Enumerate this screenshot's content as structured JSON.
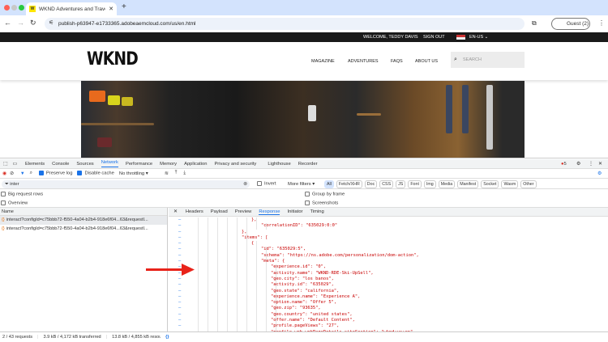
{
  "browser": {
    "tab_title": "WKND Adventures and Travel",
    "url": "publish-p63947-e1733365.adobeaemcloud.com/us/en.html",
    "profile": "Guest (2)"
  },
  "site": {
    "welcome": "WELCOME, TEDDY DAVIS",
    "sign_out": "SIGN OUT",
    "locale": "EN-US",
    "logo": "WKND",
    "nav": [
      "MAGAZINE",
      "ADVENTURES",
      "FAQS",
      "ABOUT US"
    ],
    "search_placeholder": "SEARCH"
  },
  "devtools": {
    "tabs": [
      "Elements",
      "Console",
      "Sources",
      "Network",
      "Performance",
      "Memory",
      "Application",
      "Privacy and security",
      "Lighthouse",
      "Recorder"
    ],
    "active_tab": "Network",
    "error_count": "5",
    "toolbar": {
      "preserve_log": "Preserve log",
      "disable_cache": "Disable cache",
      "throttling": "No throttling"
    },
    "filter": {
      "value": "inter",
      "invert": "Invert",
      "more_filters": "More filters",
      "types": [
        "All",
        "Fetch/XHR",
        "Doc",
        "CSS",
        "JS",
        "Font",
        "Img",
        "Media",
        "Manifest",
        "Socket",
        "Wasm",
        "Other"
      ]
    },
    "options": {
      "big_rows": "Big request rows",
      "overview": "Overview",
      "group_by_frame": "Group by frame",
      "screenshots": "Screenshots"
    },
    "list_header": "Name",
    "requests": [
      "interact?configId=c75bbb72-f550-4a04-b2b4-918e6f04...63&requestI...",
      "interact?configId=c75bbb72-f550-4a04-b2b4-918e6f04...63&requestI..."
    ],
    "detail_tabs": [
      "Headers",
      "Payload",
      "Preview",
      "Response",
      "Initiator",
      "Timing"
    ],
    "active_detail": "Response",
    "response_lines": [
      {
        "indent": 0,
        "text": "},"
      },
      {
        "indent": 1,
        "text": "\"correlationID\": \"635029:0:0\""
      },
      {
        "indent": -1,
        "text": "},"
      },
      {
        "indent": -1,
        "text": "\"items\": ["
      },
      {
        "indent": 0,
        "text": "{"
      },
      {
        "indent": 1,
        "text": "\"id\": \"635029:5\","
      },
      {
        "indent": 1,
        "text": "\"schema\": \"https://ns.adobe.com/personalization/dom-action\","
      },
      {
        "indent": 1,
        "text": "\"meta\": {"
      },
      {
        "indent": 2,
        "text": "\"experience.id\": \"0\","
      },
      {
        "indent": 2,
        "text": "\"activity.name\": \"WKND-RDE-Ski-UpSell\","
      },
      {
        "indent": 2,
        "text": "\"geo.city\": \"los banos\","
      },
      {
        "indent": 2,
        "text": "\"activity.id\": \"635029\","
      },
      {
        "indent": 2,
        "text": "\"geo.state\": \"california\","
      },
      {
        "indent": 2,
        "text": "\"experience.name\": \"Experience A\","
      },
      {
        "indent": 2,
        "text": "\"option.name\": \"Offer 5\","
      },
      {
        "indent": 2,
        "text": "\"geo.zip\": \"93635\","
      },
      {
        "indent": 2,
        "text": "\"geo.country\": \"united states\","
      },
      {
        "indent": 2,
        "text": "\"offer.name\": \"Default Content\","
      },
      {
        "indent": 2,
        "text": "\"profile.pageViews\": \"27\","
      },
      {
        "indent": 2,
        "text": "\"profile.web.webPageDetails.siteSection\": \"wknd:us:en\","
      }
    ],
    "status": {
      "requests": "2 / 43 requests",
      "transferred": "3.9 kB / 4,172 kB transferred",
      "resources": "13.8 kB / 4,855 kB resources"
    }
  },
  "colors": {
    "accent": "#1a73e8",
    "arrow": "#e8231a"
  }
}
